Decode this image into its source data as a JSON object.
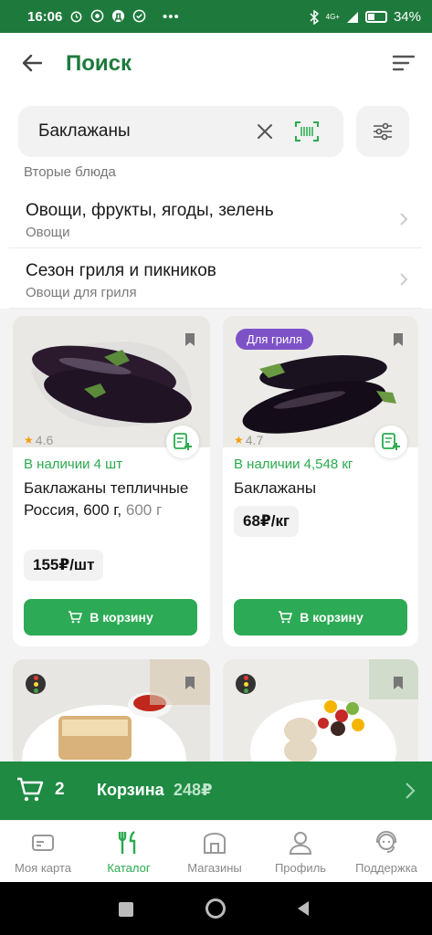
{
  "status": {
    "time": "16:06",
    "battery": "34%",
    "network": "4G+"
  },
  "header": {
    "title": "Поиск"
  },
  "search": {
    "value": "Баклажаны"
  },
  "categories": {
    "partial": "Вторые блюда",
    "rows": [
      {
        "title": "Овощи, фрукты, ягоды, зелень",
        "subtitle": "Овощи"
      },
      {
        "title": "Сезон гриля и пикников",
        "subtitle": "Овощи для гриля"
      }
    ]
  },
  "products": [
    {
      "rating": "4.6",
      "stock": "В наличии 4 шт",
      "name": "Баклажаны тепличные Россия, 600 г,",
      "weight": "600 г",
      "price": "155₽/шт",
      "button": "В корзину"
    },
    {
      "badge": "Для гриля",
      "rating": "4.7",
      "stock": "В наличии 4,548 кг",
      "name": "Баклажаны",
      "price": "68₽/кг",
      "button": "В корзину"
    }
  ],
  "cart": {
    "count": "2",
    "label": "Корзина",
    "total": "248₽"
  },
  "nav": [
    {
      "label": "Моя карта",
      "icon": "card-icon"
    },
    {
      "label": "Каталог",
      "icon": "catalog-icon"
    },
    {
      "label": "Магазины",
      "icon": "store-icon"
    },
    {
      "label": "Профиль",
      "icon": "profile-icon"
    },
    {
      "label": "Поддержка",
      "icon": "support-icon"
    }
  ],
  "colors": {
    "brand": "#1e7a3c",
    "accent": "#2daa55",
    "badge": "#7e52c7"
  }
}
